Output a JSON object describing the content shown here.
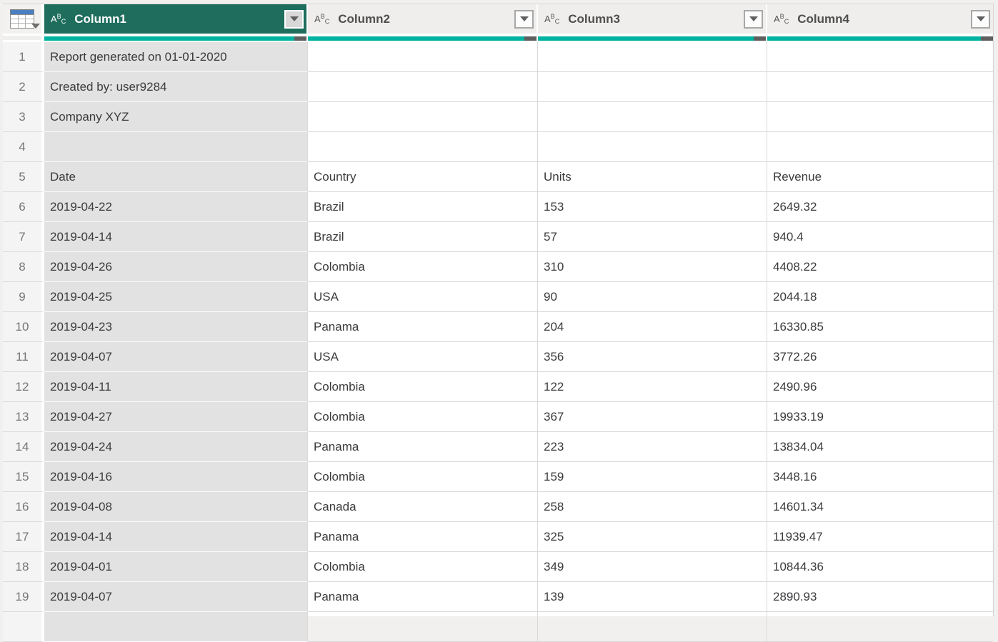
{
  "app": "Power Query data preview",
  "colors": {
    "selected_header_bg": "#1e6d5d",
    "header_bg": "#efeeec",
    "corner_bg": "#f2f1ef",
    "quality_bar_valid": "#00b3a1",
    "quality_bar_empty": "#5e5e5e",
    "selected_column_cell_bg": "#e2e2e2",
    "gutter_bg": "#f4f4f4",
    "grid_line": "#d9d9d9",
    "text": "#3b3b3e",
    "header_text": "#4f4f4f"
  },
  "type_icon": {
    "a": "A",
    "b": "B",
    "c": "C"
  },
  "table": {
    "columns": [
      {
        "label": "Column1",
        "type": "text",
        "selected": true
      },
      {
        "label": "Column2",
        "type": "text",
        "selected": false
      },
      {
        "label": "Column3",
        "type": "text",
        "selected": false
      },
      {
        "label": "Column4",
        "type": "text",
        "selected": false
      }
    ],
    "rows": [
      {
        "num": "1",
        "cells": [
          "Report generated on 01-01-2020",
          "",
          "",
          ""
        ]
      },
      {
        "num": "2",
        "cells": [
          "Created by: user9284",
          "",
          "",
          ""
        ]
      },
      {
        "num": "3",
        "cells": [
          "Company XYZ",
          "",
          "",
          ""
        ]
      },
      {
        "num": "4",
        "cells": [
          "",
          "",
          "",
          ""
        ]
      },
      {
        "num": "5",
        "cells": [
          "Date",
          "Country",
          "Units",
          "Revenue"
        ]
      },
      {
        "num": "6",
        "cells": [
          "2019-04-22",
          "Brazil",
          "153",
          "2649.32"
        ]
      },
      {
        "num": "7",
        "cells": [
          "2019-04-14",
          "Brazil",
          "57",
          "940.4"
        ]
      },
      {
        "num": "8",
        "cells": [
          "2019-04-26",
          "Colombia",
          "310",
          "4408.22"
        ]
      },
      {
        "num": "9",
        "cells": [
          "2019-04-25",
          "USA",
          "90",
          "2044.18"
        ]
      },
      {
        "num": "10",
        "cells": [
          "2019-04-23",
          "Panama",
          "204",
          "16330.85"
        ]
      },
      {
        "num": "11",
        "cells": [
          "2019-04-07",
          "USA",
          "356",
          "3772.26"
        ]
      },
      {
        "num": "12",
        "cells": [
          "2019-04-11",
          "Colombia",
          "122",
          "2490.96"
        ]
      },
      {
        "num": "13",
        "cells": [
          "2019-04-27",
          "Colombia",
          "367",
          "19933.19"
        ]
      },
      {
        "num": "14",
        "cells": [
          "2019-04-24",
          "Panama",
          "223",
          "13834.04"
        ]
      },
      {
        "num": "15",
        "cells": [
          "2019-04-16",
          "Colombia",
          "159",
          "3448.16"
        ]
      },
      {
        "num": "16",
        "cells": [
          "2019-04-08",
          "Canada",
          "258",
          "14601.34"
        ]
      },
      {
        "num": "17",
        "cells": [
          "2019-04-14",
          "Panama",
          "325",
          "11939.47"
        ]
      },
      {
        "num": "18",
        "cells": [
          "2019-04-01",
          "Colombia",
          "349",
          "10844.36"
        ]
      },
      {
        "num": "19",
        "cells": [
          "2019-04-07",
          "Panama",
          "139",
          "2890.93"
        ]
      }
    ]
  }
}
